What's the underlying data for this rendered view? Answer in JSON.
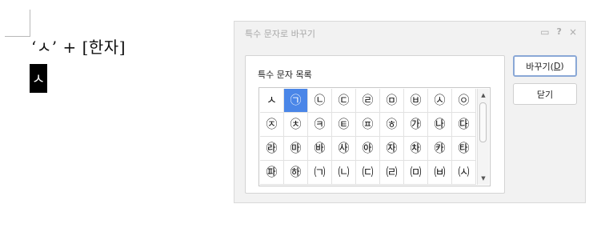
{
  "document": {
    "line_text": "‘ㅅ’ + [한자]",
    "selected_char": "ㅅ"
  },
  "dialog": {
    "title": "특수 문자로 바꾸기",
    "titlebar_icons": [
      "comment-icon",
      "help-icon",
      "close-icon"
    ],
    "titlebar_glyphs": {
      "comment": "▭",
      "help": "?",
      "close": "×"
    },
    "group_label": "특수 문자 목록",
    "selected_index": 1,
    "accent_color": "#4a86e8",
    "characters": [
      "ㅅ",
      "㉠",
      "㉡",
      "㉢",
      "㉣",
      "㉤",
      "㉥",
      "㉦",
      "㉧",
      "㉨",
      "㉩",
      "㉪",
      "㉫",
      "㉬",
      "㉭",
      "㉮",
      "㉯",
      "㉰",
      "㉱",
      "㉲",
      "㉳",
      "㉴",
      "㉵",
      "㉶",
      "㉷",
      "㉸",
      "㉹",
      "㉺",
      "㉻",
      "㈀",
      "㈁",
      "㈂",
      "㈃",
      "㈄",
      "㈅",
      "㈆"
    ],
    "scroll_up_glyph": "▲",
    "scroll_down_glyph": "▼",
    "buttons": {
      "replace_label": "바꾸기(",
      "replace_key": "D",
      "replace_suffix": ")",
      "close_label": "닫기"
    }
  }
}
